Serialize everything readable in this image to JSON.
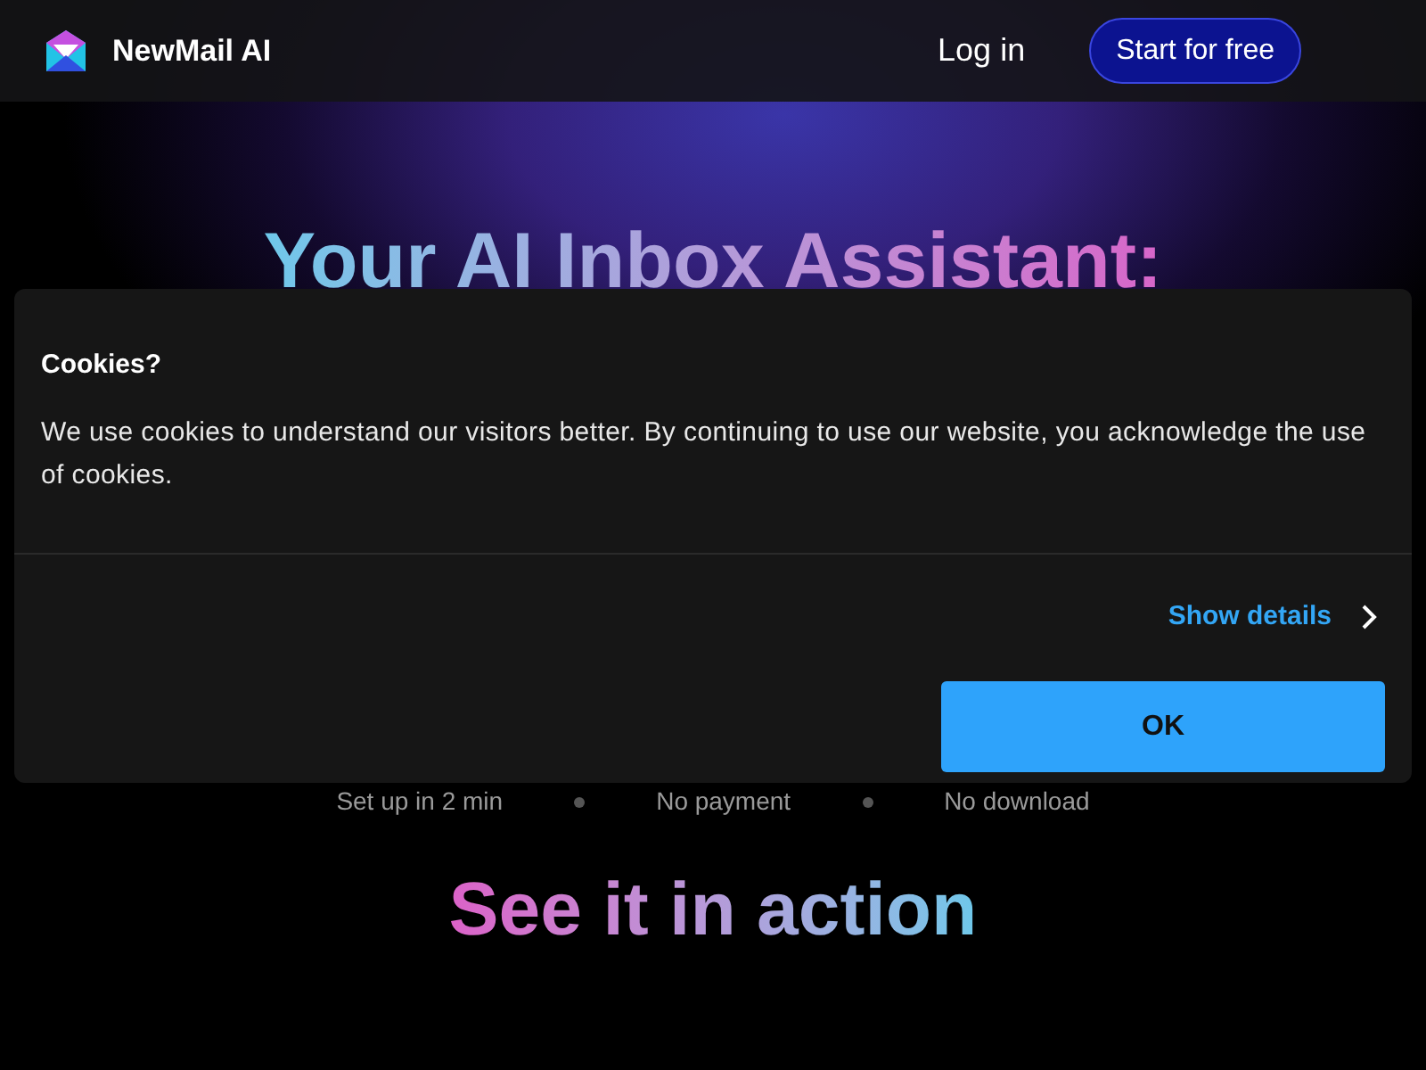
{
  "header": {
    "brand": "NewMail AI",
    "login": "Log in",
    "cta": "Start for free"
  },
  "hero": {
    "headline": "Your AI Inbox Assistant:",
    "features": [
      "Set up in 2 min",
      "No payment",
      "No download"
    ],
    "section_title": "See it in action"
  },
  "cookie_dialog": {
    "title": "Cookies?",
    "message": "We use cookies to understand our visitors better. By continuing to use our website, you acknowledge the use of cookies.",
    "details_link": "Show details",
    "ok_button": "OK"
  }
}
